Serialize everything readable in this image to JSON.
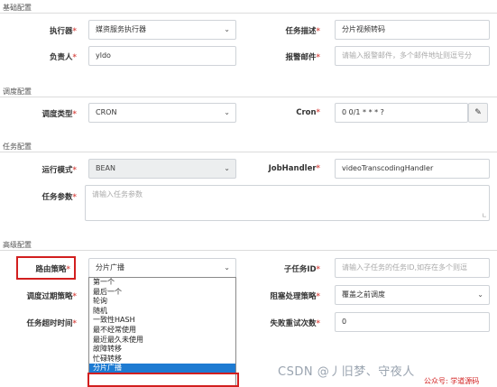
{
  "sections": {
    "basic": "基础配置",
    "schedule": "调度配置",
    "task": "任务配置",
    "advanced": "高级配置"
  },
  "fields": {
    "executor": {
      "label": "执行器",
      "value": "媒资服务执行器"
    },
    "task_desc": {
      "label": "任务描述",
      "value": "分片视频转码"
    },
    "owner": {
      "label": "负责人",
      "value": "yldo"
    },
    "alarm_email": {
      "label": "报警邮件",
      "placeholder": "请输入报警邮件，多个邮件地址则逗号分"
    },
    "schedule_type": {
      "label": "调度类型",
      "value": "CRON"
    },
    "cron": {
      "label": "Cron",
      "value": "0 0/1 * * * ?"
    },
    "run_mode": {
      "label": "运行模式",
      "value": "BEAN"
    },
    "job_handler": {
      "label": "JobHandler",
      "value": "videoTranscodingHandler"
    },
    "task_params": {
      "label": "任务参数",
      "placeholder": "请输入任务参数"
    },
    "route_strategy": {
      "label": "路由策略",
      "value": "分片广播"
    },
    "child_task": {
      "label": "子任务ID",
      "placeholder": "请输入子任务的任务ID,如存在多个则逗"
    },
    "expire_strategy": {
      "label": "调度过期策略"
    },
    "block_strategy": {
      "label": "阻塞处理策略",
      "value": "覆盖之前调度"
    },
    "timeout": {
      "label": "任务超时时间"
    },
    "retry": {
      "label": "失败重试次数",
      "value": "0"
    }
  },
  "required_mark": "*",
  "route_options": [
    "第一个",
    "最后一个",
    "轮询",
    "随机",
    "一致性HASH",
    "最不经常使用",
    "最近最久未使用",
    "故障转移",
    "忙碌转移",
    "分片广播"
  ],
  "route_selected_index": 9,
  "icons": {
    "chevron": "chevron-down-icon",
    "edit": "edit-icon",
    "resize": "resize-handle-icon"
  },
  "watermark": {
    "text": "CSDN @丿旧梦、守夜人",
    "sub": "公众号: 学道源码"
  },
  "colors": {
    "highlight_box": "#d21f1f",
    "selected_option": "#1e7bd2",
    "required": "#d9534f"
  }
}
